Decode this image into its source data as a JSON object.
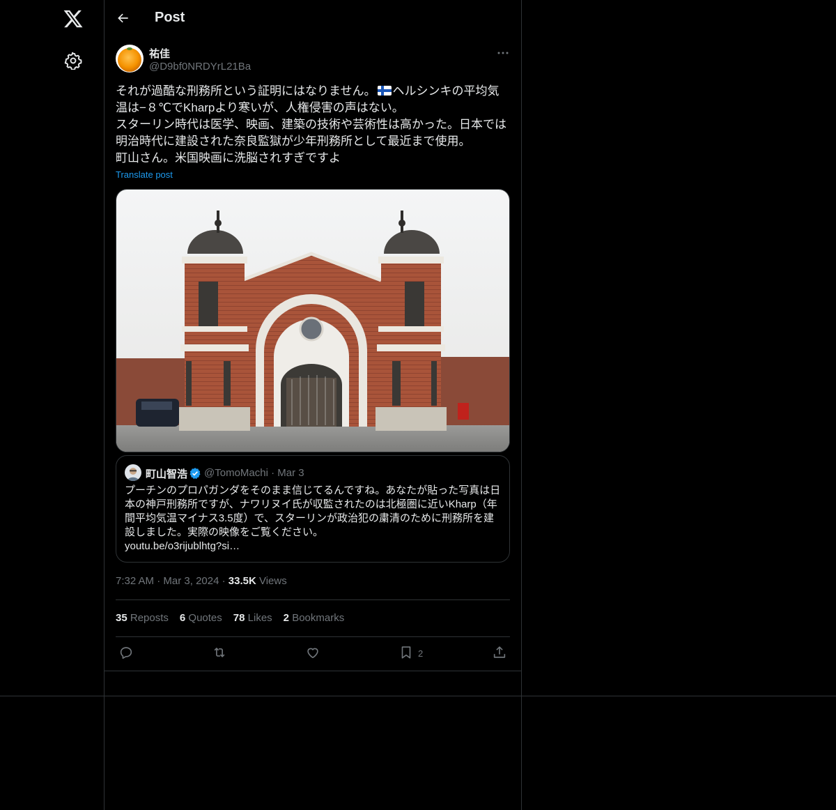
{
  "header": {
    "title": "Post"
  },
  "author": {
    "name": "祐佳",
    "handle": "@D9bf0NRDYrL21Ba"
  },
  "post": {
    "line1_a": "それが過酷な刑務所という証明にはなりません。",
    "line1_b": "ヘルシンキの平均気",
    "line2": "温は−８℃でKharpより寒いが、人権侵害の声はない。",
    "line3": "スターリン時代は医学、映画、建築の技術や芸術性は高かった。日本では",
    "line4": "明治時代に建設された奈良監獄が少年刑務所として最近まで使用。",
    "line5": "町山さん。米国映画に洗脳されすぎですよ",
    "translate": "Translate post"
  },
  "quote": {
    "name": "町山智浩",
    "handle_date": "@TomoMachi · Mar 3",
    "lines": [
      "プーチンのプロパガンダをそのまま信じてるんですね。あなたが貼った写真は日",
      "本の神戸刑務所ですが、ナワリヌイ氏が収監されたのは北極圏に近いKharp（年",
      "間平均気温マイナス3.5度）で、スターリンが政治犯の粛清のために刑務所を建",
      "設しました。実際の映像をご覧ください。",
      "youtu.be/o3rijublhtg?si…"
    ]
  },
  "meta": {
    "time": "7:32 AM",
    "dot": "·",
    "date": "Mar 3, 2024",
    "views_count": "33.5K",
    "views_label": "Views"
  },
  "stats": {
    "reposts_count": "35",
    "reposts_label": "Reposts",
    "quotes_count": "6",
    "quotes_label": "Quotes",
    "likes_count": "78",
    "likes_label": "Likes",
    "bookmarks_count": "2",
    "bookmarks_label": "Bookmarks"
  },
  "actions": {
    "bookmark_count": "2"
  },
  "colors": {
    "accent": "#1d9bf0",
    "border": "#2f3336",
    "muted": "#71767b",
    "text": "#e7e9ea"
  },
  "icons": [
    "x-logo-icon",
    "settings-gear-icon",
    "back-arrow-icon",
    "more-dots-icon",
    "finland-flag-icon",
    "verified-badge-icon",
    "reply-icon",
    "repost-icon",
    "like-icon",
    "bookmark-icon",
    "share-icon"
  ]
}
